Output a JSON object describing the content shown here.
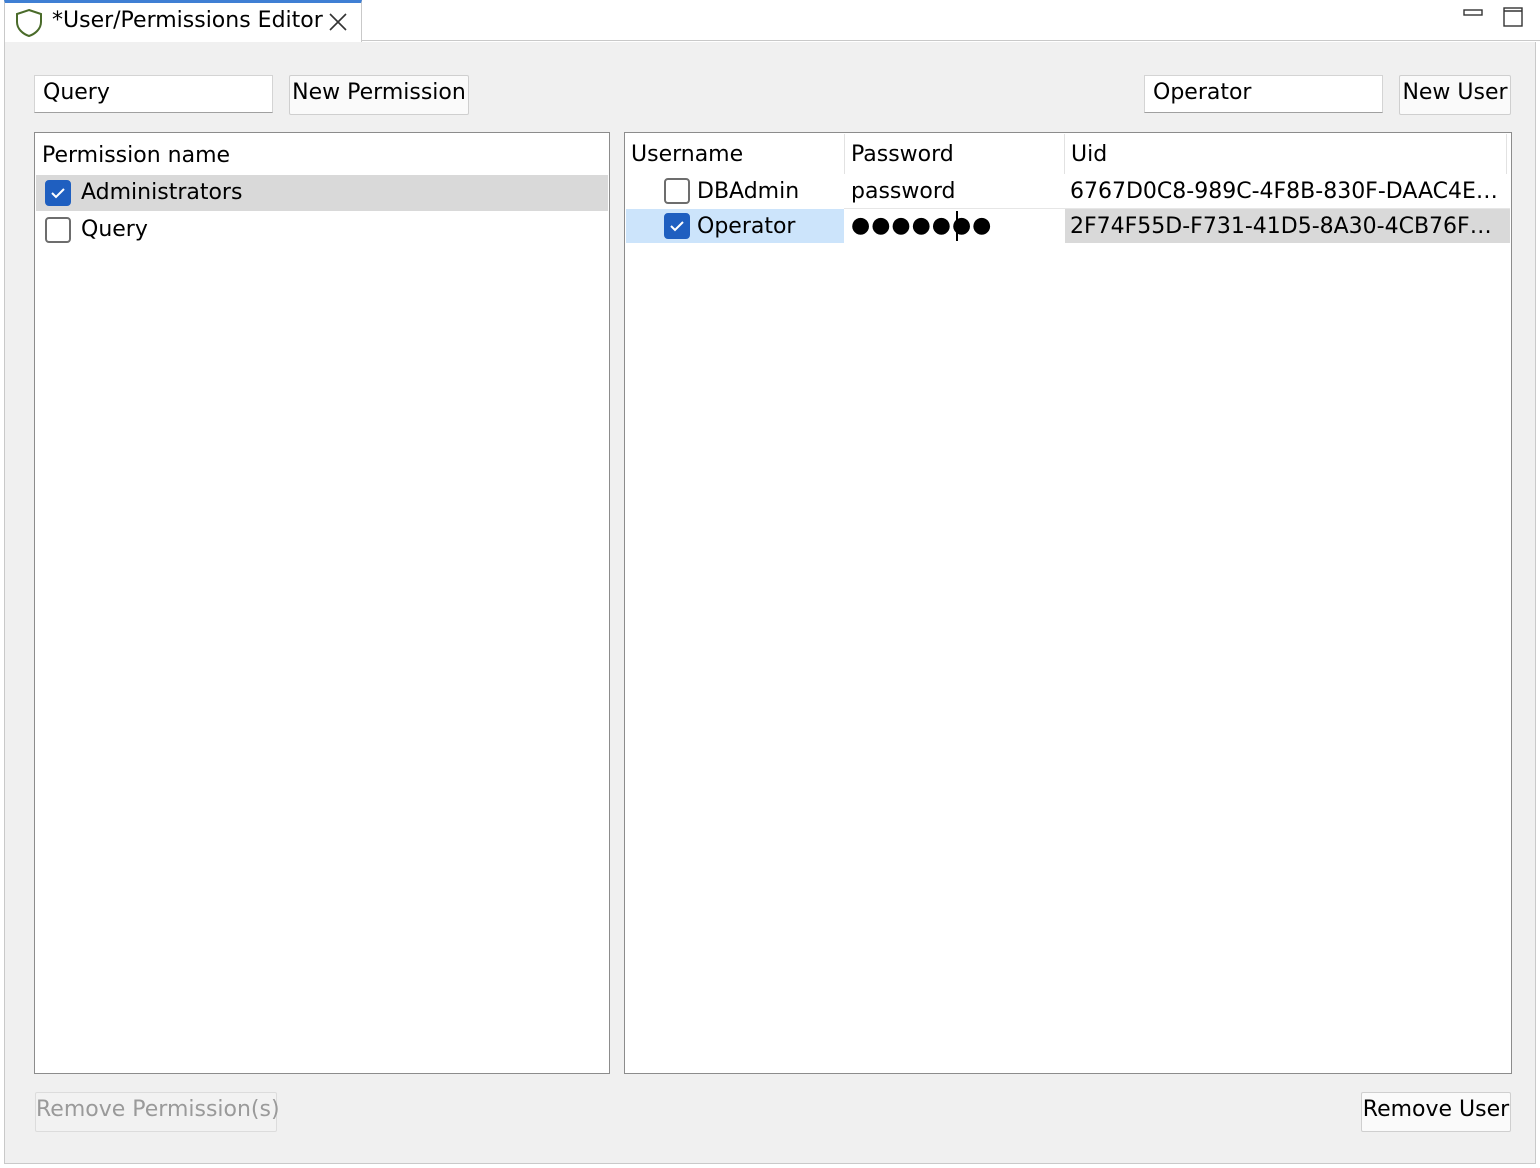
{
  "tab": {
    "title": "*User/Permissions Editor",
    "icon": "shield-icon"
  },
  "window_controls": {
    "minimize_icon": "minimize-icon",
    "maximize_icon": "maximize-icon"
  },
  "permissions": {
    "new_name_value": "Query",
    "new_button_label": "New Permission",
    "column_header": "Permission name",
    "items": [
      {
        "label": "Administrators",
        "checked": true,
        "selected": true
      },
      {
        "label": "Query",
        "checked": false,
        "selected": false
      }
    ],
    "remove_button_label": "Remove Permission(s)"
  },
  "users": {
    "new_name_value": "Operator",
    "new_button_label": "New User",
    "columns": [
      "Username",
      "Password",
      "Uid"
    ],
    "rows": [
      {
        "username": "DBAdmin",
        "password": "password",
        "uid": "6767D0C8-989C-4F8B-830F-DAAC4EC...",
        "checked": false
      },
      {
        "username": "Operator",
        "password": "●●●●●●●",
        "uid": "2F74F55D-F731-41D5-8A30-4CB76F66...",
        "checked": true,
        "selected": true
      }
    ],
    "remove_button_label": "Remove User"
  },
  "colors": {
    "tab_accent": "#3f7fd4",
    "checkbox_checked": "#1f5fc0",
    "row_selected": "#d9d9d9",
    "cell_focus": "#cce4fb",
    "shield_stroke": "#4a6b2a"
  }
}
